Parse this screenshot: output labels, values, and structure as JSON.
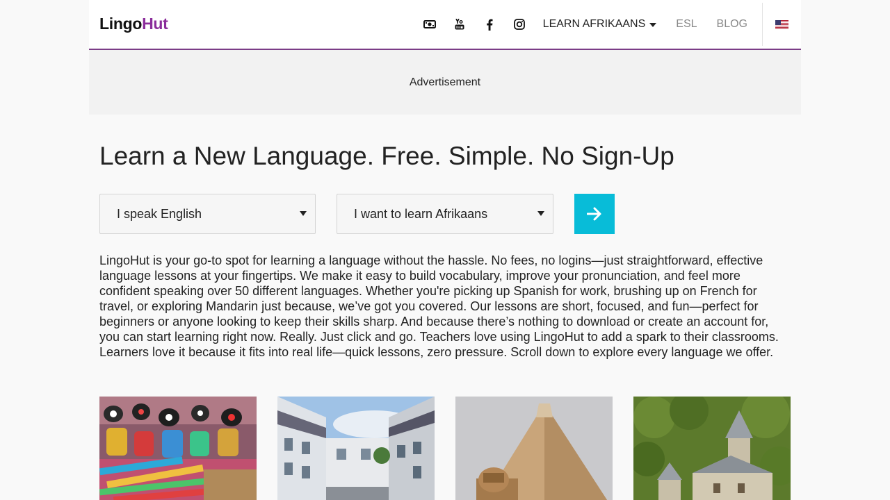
{
  "header": {
    "logo_part1": "Lingo",
    "logo_part2": "Hut",
    "icons": [
      "video-icon",
      "youtube-icon",
      "facebook-icon",
      "instagram-icon"
    ],
    "nav": {
      "learn": "LEARN AFRIKAANS",
      "esl": "ESL",
      "blog": "BLOG"
    },
    "flag": "us-flag-icon"
  },
  "ad": {
    "label": "Advertisement"
  },
  "main": {
    "title": "Learn a New Language. Free. Simple. No Sign-Up",
    "speak_select": "I speak English",
    "learn_select": "I want to learn Afrikaans",
    "go_icon": "arrow-right-icon",
    "intro": "LingoHut is your go-to spot for learning a language without the hassle. No fees, no logins—just straightforward, effective language lessons at your fingertips. We make it easy to build vocabulary, improve your pronunciation, and feel more confident speaking over 50 different languages. Whether you're picking up Spanish for work, brushing up on French for travel, or exploring Mandarin just because, we’ve got you covered. Our lessons are short, focused, and fun—perfect for beginners or anyone looking to keep their skills sharp. And because there’s nothing to download or create an account for, you can start learning right now. Really. Just click and go. Teachers love using LingoHut to add a spark to their classrooms. Learners love it because it fits into real life—quick lessons, zero pressure. Scroll down to explore every language we offer."
  },
  "colors": {
    "brand_purple": "#8a2c9a",
    "header_border": "#7b3c87",
    "go_button": "#08bcd8",
    "ad_bg": "#f2f2f2"
  }
}
